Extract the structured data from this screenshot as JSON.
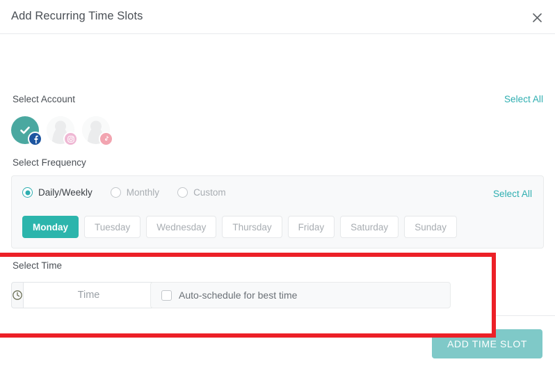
{
  "dialog": {
    "title": "Add Recurring Time Slots",
    "close_icon": "close-icon"
  },
  "account_section": {
    "label": "Select Account",
    "select_all_label": "Select All",
    "accounts": [
      {
        "network": "facebook",
        "selected": true,
        "badge_glyph": "f"
      },
      {
        "network": "instagram",
        "selected": false,
        "badge_glyph": "▣"
      },
      {
        "network": "tiktok",
        "selected": false,
        "badge_glyph": "♪"
      }
    ]
  },
  "frequency_section": {
    "label": "Select Frequency",
    "select_all_label": "Select All",
    "options": [
      {
        "label": "Daily/Weekly",
        "selected": true
      },
      {
        "label": "Monthly",
        "selected": false
      },
      {
        "label": "Custom",
        "selected": false
      }
    ],
    "days": [
      {
        "label": "Monday",
        "selected": true
      },
      {
        "label": "Tuesday",
        "selected": false
      },
      {
        "label": "Wednesday",
        "selected": false
      },
      {
        "label": "Thursday",
        "selected": false
      },
      {
        "label": "Friday",
        "selected": false
      },
      {
        "label": "Saturday",
        "selected": false
      },
      {
        "label": "Sunday",
        "selected": false
      }
    ]
  },
  "time_section": {
    "label": "Select Time",
    "time_placeholder": "Time",
    "time_value": "",
    "clock_icon": "clock-icon",
    "auto_schedule_label": "Auto-schedule for best time",
    "auto_schedule_checked": false,
    "highlight_color": "#ec2027"
  },
  "footer": {
    "submit_label": "ADD TIME SLOT"
  },
  "colors": {
    "accent_teal": "#2cb5ac",
    "link_teal": "#2eaeb0",
    "submit_teal": "#7fc9c8",
    "highlight_red": "#ec2027",
    "facebook_blue": "#1e56a0",
    "instagram_pink": "#efb8d4",
    "tiktok_pink": "#f2a4b0"
  }
}
